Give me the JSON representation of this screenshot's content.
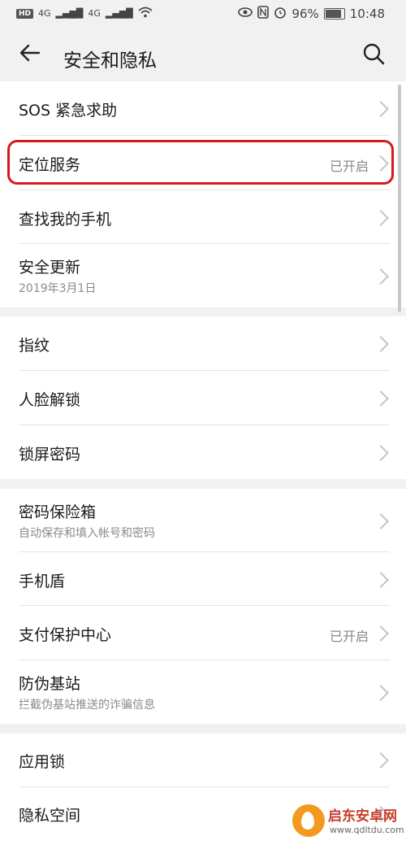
{
  "status_bar": {
    "hd": "HD",
    "signal_1": "4G",
    "signal_2": "4G",
    "battery": "96%",
    "time": "10:48"
  },
  "header": {
    "title": "安全和隐私",
    "back_icon": "back-arrow-icon",
    "search_icon": "search-icon"
  },
  "groups": [
    {
      "items": [
        {
          "label": "SOS 紧急求助"
        },
        {
          "label": "定位服务",
          "status": "已开启"
        },
        {
          "label": "查找我的手机"
        },
        {
          "label": "安全更新",
          "subtitle": "2019年3月1日"
        }
      ]
    },
    {
      "items": [
        {
          "label": "指纹"
        },
        {
          "label": "人脸解锁"
        },
        {
          "label": "锁屏密码"
        }
      ]
    },
    {
      "items": [
        {
          "label": "密码保险箱",
          "subtitle": "自动保存和填入帐号和密码"
        },
        {
          "label": "手机盾"
        },
        {
          "label": "支付保护中心",
          "status": "已开启"
        },
        {
          "label": "防伪基站",
          "subtitle": "拦截伪基站推送的诈骗信息"
        }
      ]
    },
    {
      "items": [
        {
          "label": "应用锁"
        },
        {
          "label": "隐私空间"
        }
      ]
    }
  ],
  "watermark": {
    "name": "启东安卓网",
    "url": "www.qdltdu.com"
  },
  "highlight_color": "#d41a1a"
}
